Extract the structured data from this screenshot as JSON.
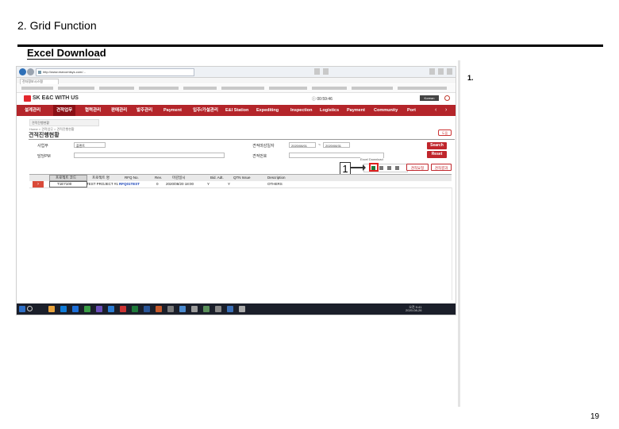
{
  "doc": {
    "title": "2. Grid Function",
    "section": "Excel Download",
    "step_number": "1.",
    "page_number": "19"
  },
  "browser": {
    "url": "http://www.esecomtsys.com/...",
    "tab_label": "전자정보시스템"
  },
  "app": {
    "logo_text": "SK E&C WITH US",
    "user_info": "ⓘ 00:59:46",
    "language": "Korean",
    "menu": [
      {
        "label": "설계관리"
      },
      {
        "label": "견적업무",
        "active": true
      },
      {
        "label": "협력관리"
      },
      {
        "label": "판매관리"
      },
      {
        "label": "발주관리"
      },
      {
        "label": "Payment"
      },
      {
        "label": "입주/가설관리"
      },
      {
        "label": "E&I Station"
      },
      {
        "label": "Expediting"
      },
      {
        "label": "Inspection"
      },
      {
        "label": "Logistics"
      },
      {
        "label": "Payment"
      },
      {
        "label": "Community"
      },
      {
        "label": "Port"
      }
    ],
    "breadcrumb": "Home > 견적업무 > 견적진행현황",
    "page_title": "견적진행현황",
    "help_label": "도움",
    "filters": {
      "project_label": "사업부",
      "project_value": "플랜트",
      "date_label": "견적마감일자",
      "date_from": "2020/08/01",
      "date_sep": "~",
      "date_to": "2020/08/31",
      "pm_label": "담당PM",
      "rfq_label": "견적번호"
    },
    "buttons": {
      "search": "Search",
      "reset": "Reset",
      "excel_tooltip": "Excel Download",
      "btn_a": "견적요청",
      "btn_b": "견적결과"
    },
    "callout": "1",
    "grid": {
      "columns": [
        "프로젝트 코드",
        "프로젝트 명",
        "RFQ No.",
        "Rev.",
        "마감일시",
        "Bid. Adt.",
        "QTN Issue",
        "Description"
      ],
      "rows": [
        [
          "T1E7100",
          "TEST PROJECT #1",
          "RFQ01TEST",
          "0",
          "2020/08/20 18:00",
          "Y",
          "Y",
          "OTHERS"
        ]
      ]
    },
    "taskbar": {
      "time": "오전 9:41",
      "date": "2020-08-26"
    }
  }
}
